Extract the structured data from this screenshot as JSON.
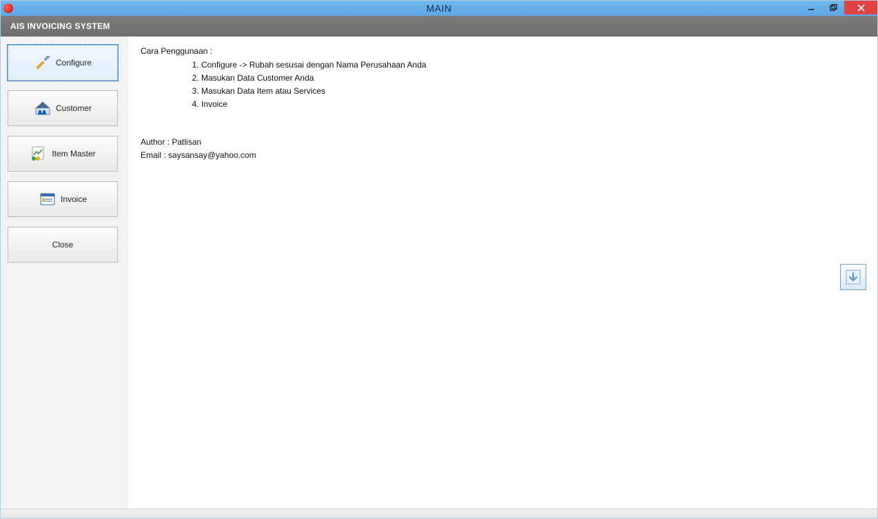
{
  "window": {
    "title": "MAIN"
  },
  "ribbon": {
    "brand": "AIS INVOICING SYSTEM"
  },
  "sidebar": {
    "buttons": {
      "configure": "Configure",
      "customer": "Customer",
      "item_master": "Item Master",
      "invoice": "Invoice",
      "close": "Close"
    }
  },
  "content": {
    "heading": "Cara Penggunaan :",
    "steps": [
      "Configure -> Rubah sesusai dengan Nama Perusahaan Anda",
      "Masukan Data Customer Anda",
      "Masukan Data Item atau Services",
      "Invoice"
    ],
    "author_label": "Author : ",
    "author_name": "Patlisan",
    "email_label": "Email : ",
    "email_value": "saysansay@yahoo.com"
  },
  "icons": {
    "configure": "tools-icon",
    "customer": "house-people-icon",
    "item_master": "document-chart-icon",
    "invoice": "form-icon",
    "download_arrow": "arrow-down-icon"
  }
}
